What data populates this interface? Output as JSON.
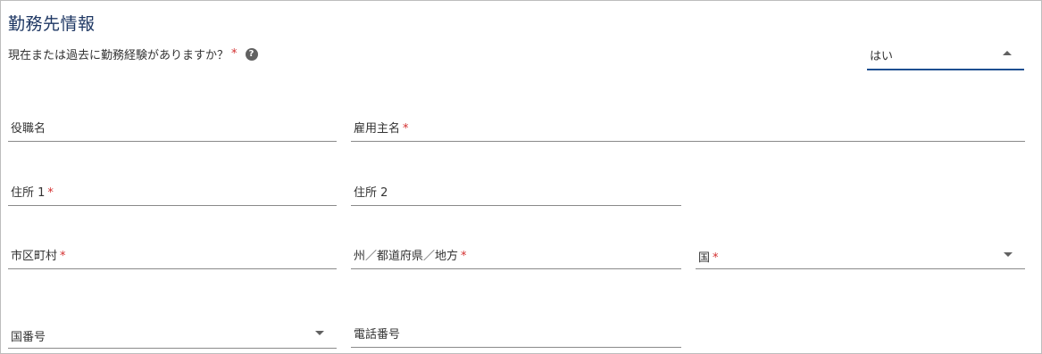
{
  "section": {
    "title": "勤務先情報"
  },
  "question": {
    "text": "現在または過去に勤務経験がありますか？",
    "required_mark": "*",
    "help_icon": "question-circle-icon"
  },
  "experience_select": {
    "value": "はい"
  },
  "fields": {
    "job_title": {
      "label": "役職名",
      "required": ""
    },
    "employer_name": {
      "label": "雇用主名",
      "required": "*"
    },
    "address1": {
      "label": "住所 1",
      "required": "*"
    },
    "address2": {
      "label": "住所 2",
      "required": ""
    },
    "city": {
      "label": "市区町村",
      "required": "*"
    },
    "state": {
      "label": "州／都道府県／地方",
      "required": "*"
    },
    "country": {
      "label": "国",
      "required": "*"
    },
    "country_code": {
      "label": "国番号",
      "required": ""
    },
    "phone": {
      "label": "電話番号",
      "required": ""
    }
  },
  "colors": {
    "title": "#1f3864",
    "required": "#d32f2f",
    "focus_underline": "#1e4f91",
    "underline": "#8a8a8a"
  }
}
